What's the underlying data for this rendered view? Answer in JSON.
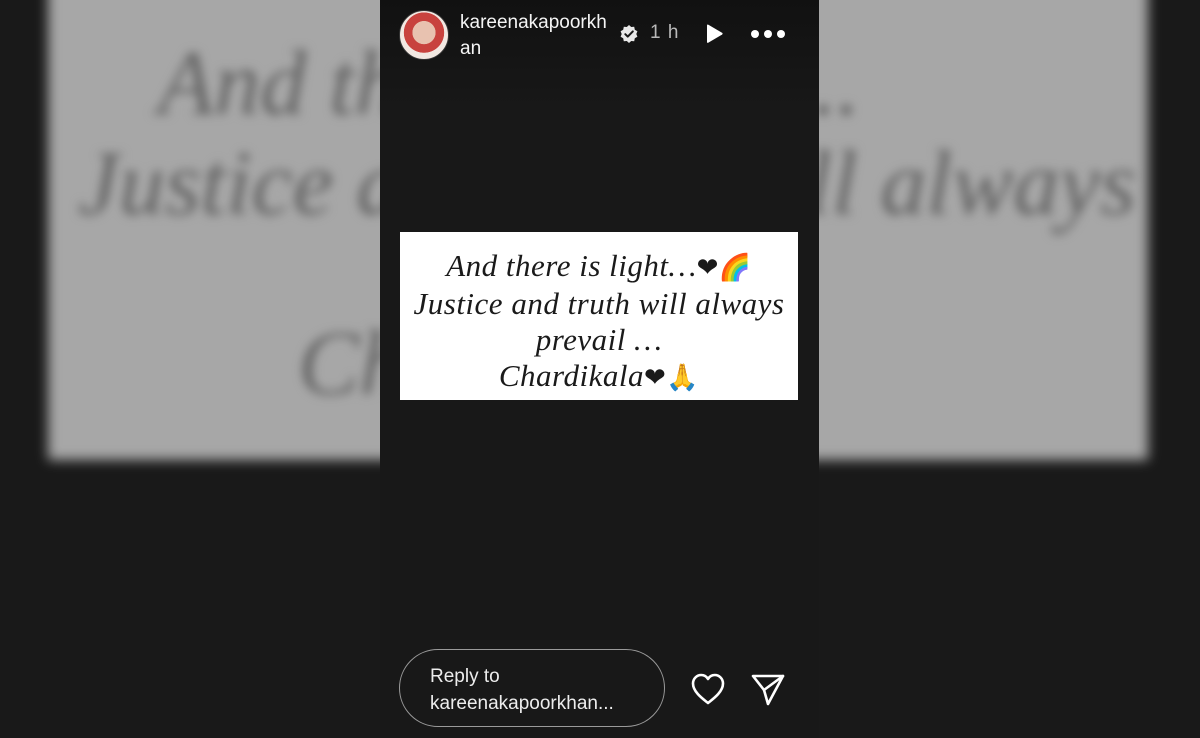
{
  "background": {
    "line1": "And there is light...",
    "line2": "Justice and truth will always",
    "line3": "Chardikala"
  },
  "header": {
    "username": "kareenakapoorkhan",
    "verified_icon": "verified-badge-icon",
    "time": "1 h",
    "play_icon": "play-icon",
    "more_icon": "more-horizontal-icon"
  },
  "story_card": {
    "line1": "And there is light…",
    "line1_emoji": "❤🌈",
    "line2": "Justice and truth will always",
    "line3": "prevail …",
    "line4": "Chardikala",
    "line4_emoji": "❤🙏"
  },
  "footer": {
    "reply_line1": "Reply to",
    "reply_line2": "kareenakapoorkhan...",
    "like_icon": "heart-icon",
    "share_icon": "send-icon"
  },
  "colors": {
    "panel": "#181818",
    "backdrop": "#232323",
    "card": "#ffffff",
    "text": "#f5f5f5"
  }
}
